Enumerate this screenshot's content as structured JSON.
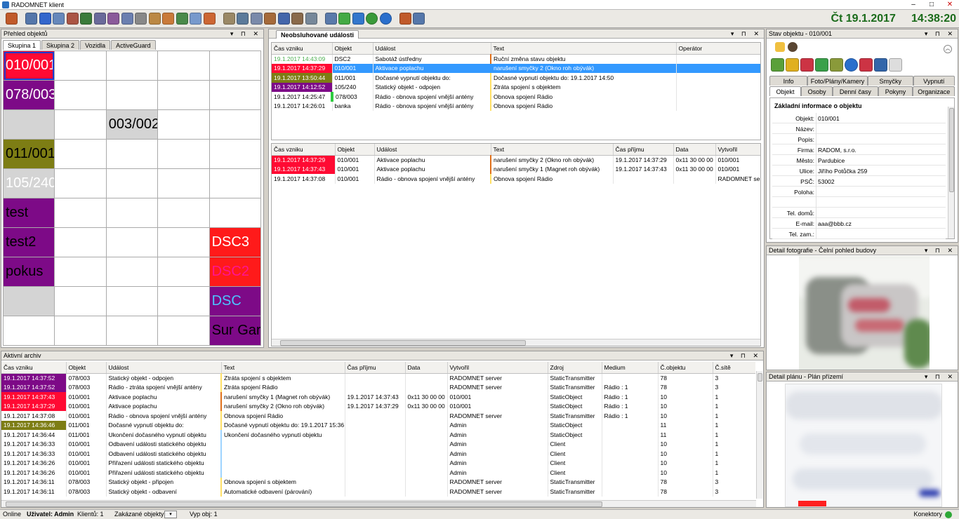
{
  "app": {
    "title": "RADOMNET klient",
    "date": "Čt 19.1.2017",
    "time": "14:38:20"
  },
  "overview": {
    "title": "Přehled objektů",
    "tabs": [
      "Skupina 1",
      "Skupina 2",
      "Vozidla",
      "ActiveGuard"
    ],
    "cells": [
      {
        "label": "010/001",
        "bg": "#ff0a33",
        "fg": "#ffffff",
        "row": 0,
        "col": 0,
        "selected": true
      },
      {
        "label": "078/003",
        "bg": "#7d0a87",
        "fg": "#ffffff",
        "row": 1,
        "col": 0
      },
      {
        "label": "",
        "bg": "#d4d4d4",
        "fg": "#000000",
        "row": 2,
        "col": 0
      },
      {
        "label": "003/002",
        "bg": "#d4d4d4",
        "fg": "#000000",
        "row": 2,
        "col": 2
      },
      {
        "label": "011/001",
        "bg": "#7d7d14",
        "fg": "#000000",
        "row": 3,
        "col": 0
      },
      {
        "label": "105/240",
        "bg": "#d4d4d4",
        "fg": "#ffffff",
        "row": 4,
        "col": 0
      },
      {
        "label": "test",
        "bg": "#7d0a87",
        "fg": "#000000",
        "row": 5,
        "col": 0
      },
      {
        "label": "test2",
        "bg": "#7d0a87",
        "fg": "#000000",
        "row": 6,
        "col": 0
      },
      {
        "label": "DSC3",
        "bg": "#ff1a1a",
        "fg": "#ffffff",
        "row": 6,
        "col": 4
      },
      {
        "label": "pokus",
        "bg": "#7d0a87",
        "fg": "#000000",
        "row": 7,
        "col": 0
      },
      {
        "label": "DSC2",
        "bg": "#ff1a1a",
        "fg": "#ff1493",
        "row": 7,
        "col": 4
      },
      {
        "label": "",
        "bg": "#d4d4d4",
        "fg": "#000000",
        "row": 8,
        "col": 0
      },
      {
        "label": "DSC",
        "bg": "#7d0a87",
        "fg": "#4dc3ff",
        "row": 8,
        "col": 4
      },
      {
        "label": "Sur Gard",
        "bg": "#7d0a87",
        "fg": "#000000",
        "row": 9,
        "col": 4
      }
    ]
  },
  "unhandled": {
    "tab": "Neobsluhované události",
    "headers": [
      "Čas vzniku",
      "Objekt",
      "Událost",
      "Text",
      "Operátor"
    ],
    "rows": [
      {
        "time": "19.1.2017  14:43:09",
        "obj": "DSC2",
        "event": "Sabotáž ústředny",
        "text": "Ruční změna stavu objektu",
        "op": "",
        "tbg": "#ffffff",
        "tfg": "#4caf50",
        "bar": "#e0701a"
      },
      {
        "time": "19.1.2017  14:37:29",
        "obj": "010/001",
        "event": "Aktivace poplachu",
        "text": "narušení smyčky 2 (Okno roh obývák)",
        "op": "",
        "tbg": "#ff0a33",
        "tfg": "#ffffff",
        "bar": "#3399ff",
        "selected": true
      },
      {
        "time": "19.1.2017  13:50:44",
        "obj": "011/001",
        "event": "Dočasné vypnutí objektu do:",
        "text": "Dočasné vypnutí objektu do: 19.1.2017 14:50",
        "op": "",
        "tbg": "#7d7d14",
        "tfg": "#ffffff",
        "bar": "#ffe066"
      },
      {
        "time": "19.1.2017  14:12:52",
        "obj": "105/240",
        "event": "Statický objekt - odpojen",
        "text": "Ztráta spojení s objektem",
        "op": "",
        "tbg": "#7d0a87",
        "tfg": "#ffffff",
        "bar": "#ffe066"
      },
      {
        "time": "19.1.2017  14:25:47",
        "obj": "078/003",
        "event": "Rádio - obnova spojení vnější antény",
        "text": "Obnova spojení Rádio",
        "op": "",
        "tbg": "#ffffff",
        "tfg": "#000000",
        "bar": "#ffe066",
        "objbar": "#2ecc40"
      },
      {
        "time": "19.1.2017  14:26:01",
        "obj": "banka",
        "event": "Rádio - obnova spojení vnější antény",
        "text": "Obnova spojení Rádio",
        "op": "",
        "tbg": "#ffffff",
        "tfg": "#000000",
        "bar": "#ffe066"
      }
    ],
    "detail_headers": [
      "Čas vzniku",
      "Objekt",
      "Událost",
      "Text",
      "Čas příjmu",
      "Data",
      "Vytvořil"
    ],
    "detail_rows": [
      {
        "time": "19.1.2017  14:37:29",
        "obj": "010/001",
        "event": "Aktivace poplachu",
        "text": "narušení smyčky 2 (Okno roh obývák)",
        "recv": "19.1.2017   14:37:29",
        "data": "0x11 30 00 00",
        "by": "010/001",
        "tbg": "#ff0a33",
        "tfg": "#ffffff",
        "bar": "#e0701a"
      },
      {
        "time": "19.1.2017  14:37:43",
        "obj": "010/001",
        "event": "Aktivace poplachu",
        "text": "narušení smyčky 1 (Magnet roh obývák)",
        "recv": "19.1.2017   14:37:43",
        "data": "0x11 30 00 00",
        "by": "010/001",
        "tbg": "#ff0a33",
        "tfg": "#ffffff",
        "bar": "#e0701a"
      },
      {
        "time": "19.1.2017  14:37:08",
        "obj": "010/001",
        "event": "Rádio - obnova spojení vnější antény",
        "text": "Obnova spojení Rádio",
        "recv": "",
        "data": "",
        "by": "RADOMNET server",
        "tbg": "#ffffff",
        "tfg": "#000000",
        "bar": "#ffe066"
      }
    ]
  },
  "archive": {
    "title": "Aktivní archiv",
    "headers": [
      "Čas vzniku",
      "Objekt",
      "Událost",
      "Text",
      "Čas příjmu",
      "Data",
      "Vytvořil",
      "Zdroj",
      "Medium",
      "Č.objektu",
      "Č.sítě"
    ],
    "rows": [
      {
        "time": "19.1.2017  14:37:52",
        "obj": "078/003",
        "event": "Statický objekt - odpojen",
        "text": "Ztráta spojení s objektem",
        "recv": "",
        "data": "",
        "by": "RADOMNET server",
        "src": "StaticTransmitter",
        "med": "",
        "no": "78",
        "net": "3",
        "tbg": "#7d0a87",
        "tfg": "#ffffff",
        "bar": "#ffe066"
      },
      {
        "time": "19.1.2017  14:37:52",
        "obj": "078/003",
        "event": "Rádio - ztráta spojení vnější antény",
        "text": "Ztráta spojení Rádio",
        "recv": "",
        "data": "",
        "by": "RADOMNET server",
        "src": "StaticTransmitter",
        "med": "Rádio : 1",
        "no": "78",
        "net": "3",
        "tbg": "#7d0a87",
        "tfg": "#ffffff",
        "bar": "#ffe066"
      },
      {
        "time": "19.1.2017  14:37:43",
        "obj": "010/001",
        "event": "Aktivace poplachu",
        "text": "narušení smyčky 1 (Magnet roh obývák)",
        "recv": "19.1.2017   14:37:43",
        "data": "0x11 30 00 00",
        "by": "010/001",
        "src": "StaticObject",
        "med": "Rádio : 1",
        "no": "10",
        "net": "1",
        "tbg": "#ff0a33",
        "tfg": "#ffffff",
        "bar": "#e0701a"
      },
      {
        "time": "19.1.2017  14:37:29",
        "obj": "010/001",
        "event": "Aktivace poplachu",
        "text": "narušení smyčky 2 (Okno roh obývák)",
        "recv": "19.1.2017   14:37:29",
        "data": "0x11 30 00 00",
        "by": "010/001",
        "src": "StaticObject",
        "med": "Rádio : 1",
        "no": "10",
        "net": "1",
        "tbg": "#ff0a33",
        "tfg": "#ffffff",
        "bar": "#e0701a"
      },
      {
        "time": "19.1.2017  14:37:08",
        "obj": "010/001",
        "event": "Rádio - obnova spojení vnější antény",
        "text": "Obnova spojení Rádio",
        "recv": "",
        "data": "",
        "by": "RADOMNET server",
        "src": "StaticTransmitter",
        "med": "Rádio : 1",
        "no": "10",
        "net": "1",
        "tbg": "#ffffff",
        "tfg": "#000000",
        "bar": "#ffe066"
      },
      {
        "time": "19.1.2017  14:36:46",
        "obj": "011/001",
        "event": "Dočasné vypnutí objektu do:",
        "text": "Dočasné vypnutí objektu do: 19.1.2017 15:36",
        "recv": "",
        "data": "",
        "by": "Admin",
        "src": "StaticObject",
        "med": "",
        "no": "11",
        "net": "1",
        "tbg": "#7d7d14",
        "tfg": "#ffffff",
        "bar": "#ffe066"
      },
      {
        "time": "19.1.2017  14:36:44",
        "obj": "011/001",
        "event": "Ukončení dočasného vypnutí objektu",
        "text": "Ukončení dočasného vypnutí objektu",
        "recv": "",
        "data": "",
        "by": "Admin",
        "src": "StaticObject",
        "med": "",
        "no": "11",
        "net": "1",
        "tbg": "#ffffff",
        "tfg": "#000000",
        "bar": "#9fd4ff"
      },
      {
        "time": "19.1.2017  14:36:33",
        "obj": "010/001",
        "event": "Odbavení události statického objektu",
        "text": "",
        "recv": "",
        "data": "",
        "by": "Admin",
        "src": "Client",
        "med": "",
        "no": "10",
        "net": "1",
        "tbg": "#ffffff",
        "tfg": "#000000",
        "bar": "#9fd4ff"
      },
      {
        "time": "19.1.2017  14:36:33",
        "obj": "010/001",
        "event": "Odbavení události statického objektu",
        "text": "",
        "recv": "",
        "data": "",
        "by": "Admin",
        "src": "Client",
        "med": "",
        "no": "10",
        "net": "1",
        "tbg": "#ffffff",
        "tfg": "#000000",
        "bar": "#9fd4ff"
      },
      {
        "time": "19.1.2017  14:36:26",
        "obj": "010/001",
        "event": "Přiřazení události statického objektu",
        "text": "",
        "recv": "",
        "data": "",
        "by": "Admin",
        "src": "Client",
        "med": "",
        "no": "10",
        "net": "1",
        "tbg": "#ffffff",
        "tfg": "#000000",
        "bar": "#9fd4ff"
      },
      {
        "time": "19.1.2017  14:36:26",
        "obj": "010/001",
        "event": "Přiřazení události statického objektu",
        "text": "",
        "recv": "",
        "data": "",
        "by": "Admin",
        "src": "Client",
        "med": "",
        "no": "10",
        "net": "1",
        "tbg": "#ffffff",
        "tfg": "#000000",
        "bar": "#9fd4ff"
      },
      {
        "time": "19.1.2017  14:36:11",
        "obj": "078/003",
        "event": "Statický objekt - připojen",
        "text": "Obnova spojení s objektem",
        "recv": "",
        "data": "",
        "by": "RADOMNET server",
        "src": "StaticTransmitter",
        "med": "",
        "no": "78",
        "net": "3",
        "tbg": "#ffffff",
        "tfg": "#000000",
        "bar": "#ffe066"
      },
      {
        "time": "19.1.2017  14:36:11",
        "obj": "078/003",
        "event": "Statický objekt - odbavení",
        "text": "Automatické odbavení (párování)",
        "recv": "",
        "data": "",
        "by": "RADOMNET server",
        "src": "StaticTransmitter",
        "med": "",
        "no": "78",
        "net": "3",
        "tbg": "#ffffff",
        "tfg": "#000000",
        "bar": "#ffe066"
      }
    ]
  },
  "objstate": {
    "title": "Stav objektu - 010/001",
    "tabs_top": [
      "Info",
      "Foto/Plány/Kamery",
      "Smyčky",
      "Vypnutí"
    ],
    "tabs_bottom": [
      "Objekt",
      "Osoby",
      "Denní časy",
      "Pokyny",
      "Organizace"
    ],
    "section": "Základní informace o objektu",
    "fields": [
      {
        "label": "Objekt:",
        "value": "010/001"
      },
      {
        "label": "Název:",
        "value": ""
      },
      {
        "label": "Popis:",
        "value": ""
      },
      {
        "label": "Firma:",
        "value": "RADOM, s.r.o."
      },
      {
        "label": "Město:",
        "value": "Pardubice"
      },
      {
        "label": "Ulice:",
        "value": "Jiřího Potůčka 259"
      },
      {
        "label": "PSČ:",
        "value": "53002"
      },
      {
        "label": "Poloha:",
        "value": ""
      },
      {
        "label": "",
        "value": ""
      },
      {
        "label": "Tel. domů:",
        "value": ""
      },
      {
        "label": "E-mail:",
        "value": "aaa@bbb.cz"
      },
      {
        "label": "Tel. zam.:",
        "value": ""
      }
    ]
  },
  "photo": {
    "title": "Detail fotografie - Čelní pohled budovy"
  },
  "plan": {
    "title": "Detail plánu - Plán přízemí"
  },
  "status": {
    "online": "Online",
    "user": "Uživatel: Admin",
    "clients": "Klientů: 1",
    "forbidden": "Zakázané objekty:",
    "vyp": "Vyp obj: 1",
    "connectors": "Konektory"
  }
}
